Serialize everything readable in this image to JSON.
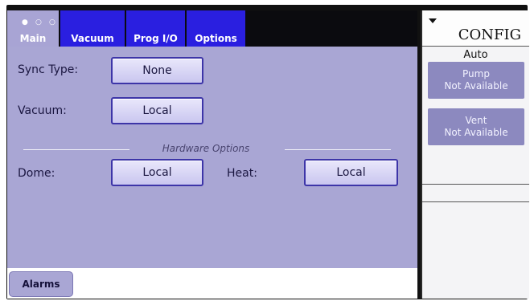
{
  "tabs": [
    {
      "label": "Main",
      "active": true
    },
    {
      "label": "Vacuum",
      "active": false
    },
    {
      "label": "Prog I/O",
      "active": false
    },
    {
      "label": "Options",
      "active": false
    }
  ],
  "main_tab_dots": "● ○ ○",
  "fields": {
    "sync_type": {
      "label": "Sync Type:",
      "value": "None"
    },
    "vacuum": {
      "label": "Vacuum:",
      "value": "Local"
    },
    "hardware_options_title": "Hardware Options",
    "dome": {
      "label": "Dome:",
      "value": "Local"
    },
    "heat": {
      "label": "Heat:",
      "value": "Local"
    }
  },
  "bottom": {
    "alarms_label": "Alarms"
  },
  "config": {
    "title": "CONFIG",
    "mode": "Auto",
    "pump": {
      "title": "Pump",
      "status": "Not Available"
    },
    "vent": {
      "title": "Vent",
      "status": "Not Available"
    }
  },
  "colors": {
    "tab_blue": "#2a1fe0",
    "panel_lavender": "#a9a6d4",
    "side_button": "#8c89bf"
  }
}
